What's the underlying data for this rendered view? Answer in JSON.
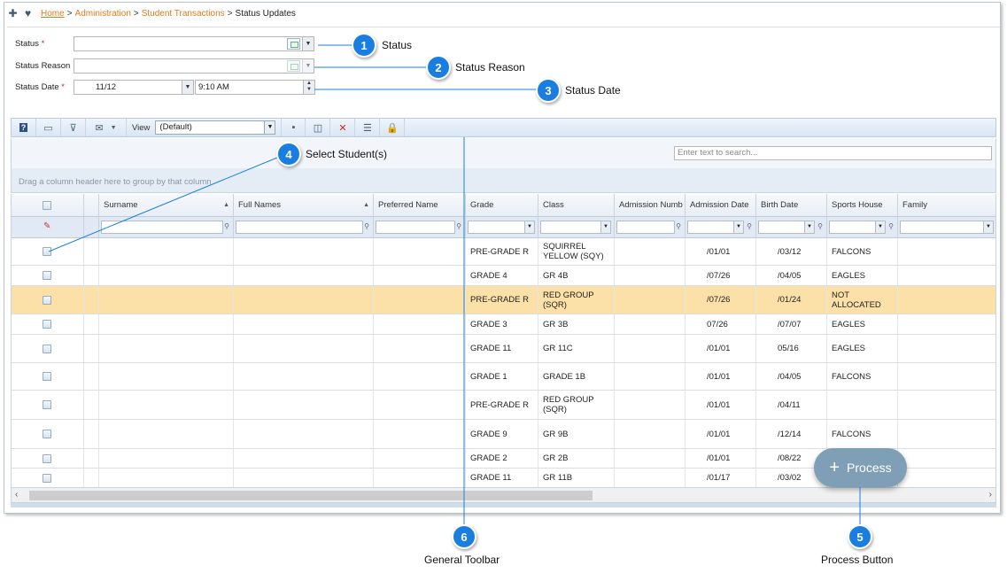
{
  "breadcrumb": {
    "home": "Home",
    "admin": "Administration",
    "transactions": "Student Transactions",
    "current": "Status Updates",
    "sep": ">"
  },
  "form": {
    "status_label": "Status",
    "status_reason_label": "Status Reason",
    "status_date_label": "Status Date",
    "required_mark": "*",
    "date_value": "11/12",
    "time_value": "9:10 AM"
  },
  "toolbar": {
    "view_label": "View",
    "view_value": "(Default)"
  },
  "search": {
    "placeholder": "Enter text to search..."
  },
  "group_hint": "Drag a column header here to group by that column",
  "columns": [
    "Surname",
    "Full Names",
    "Preferred Name",
    "Grade",
    "Class",
    "Admission Numb",
    "Admission Date",
    "Birth Date",
    "Sports House",
    "Family"
  ],
  "rows": [
    {
      "grade": "PRE-GRADE R",
      "class": "SQUIRREL YELLOW (SQY)",
      "adm": "/01/01",
      "birth": "/03/12",
      "house": "FALCONS"
    },
    {
      "grade": "GRADE 4",
      "class": "GR 4B",
      "adm": "/07/26",
      "birth": "/04/05",
      "house": "EAGLES"
    },
    {
      "grade": "PRE-GRADE R",
      "class": "RED GROUP (SQR)",
      "adm": "/07/26",
      "birth": "/01/24",
      "house": "NOT ALLOCATED"
    },
    {
      "grade": "GRADE 3",
      "class": "GR 3B",
      "adm": "07/26",
      "birth": "/07/07",
      "house": "EAGLES"
    },
    {
      "grade": "GRADE 11",
      "class": "GR 11C",
      "adm": "/01/01",
      "birth": "05/16",
      "house": "EAGLES"
    },
    {
      "grade": "GRADE 1",
      "class": "GRADE 1B",
      "adm": "/01/01",
      "birth": "/04/05",
      "house": "FALCONS"
    },
    {
      "grade": "PRE-GRADE R",
      "class": "RED GROUP (SQR)",
      "adm": "/01/01",
      "birth": "/04/11",
      "house": ""
    },
    {
      "grade": "GRADE 9",
      "class": "GR 9B",
      "adm": "/01/01",
      "birth": "/12/14",
      "house": "FALCONS"
    },
    {
      "grade": "GRADE 2",
      "class": "GR 2B",
      "adm": "/01/01",
      "birth": "/08/22",
      "house": ""
    },
    {
      "grade": "GRADE 11",
      "class": "GR 11B",
      "adm": "/01/17",
      "birth": "/03/02",
      "house": ""
    }
  ],
  "process_button": {
    "label": "Process"
  },
  "callouts": [
    {
      "num": "1",
      "text": "Status"
    },
    {
      "num": "2",
      "text": "Status Reason"
    },
    {
      "num": "3",
      "text": "Status Date"
    },
    {
      "num": "4",
      "text": "Select Student(s)"
    },
    {
      "num": "5",
      "text": "Process Button"
    },
    {
      "num": "6",
      "text": "General Toolbar"
    }
  ],
  "colors": {
    "accent": "#1a7ee0",
    "link": "#e07a1f",
    "selected_row": "#fbe0a8",
    "fab": "#7f9fb6"
  }
}
